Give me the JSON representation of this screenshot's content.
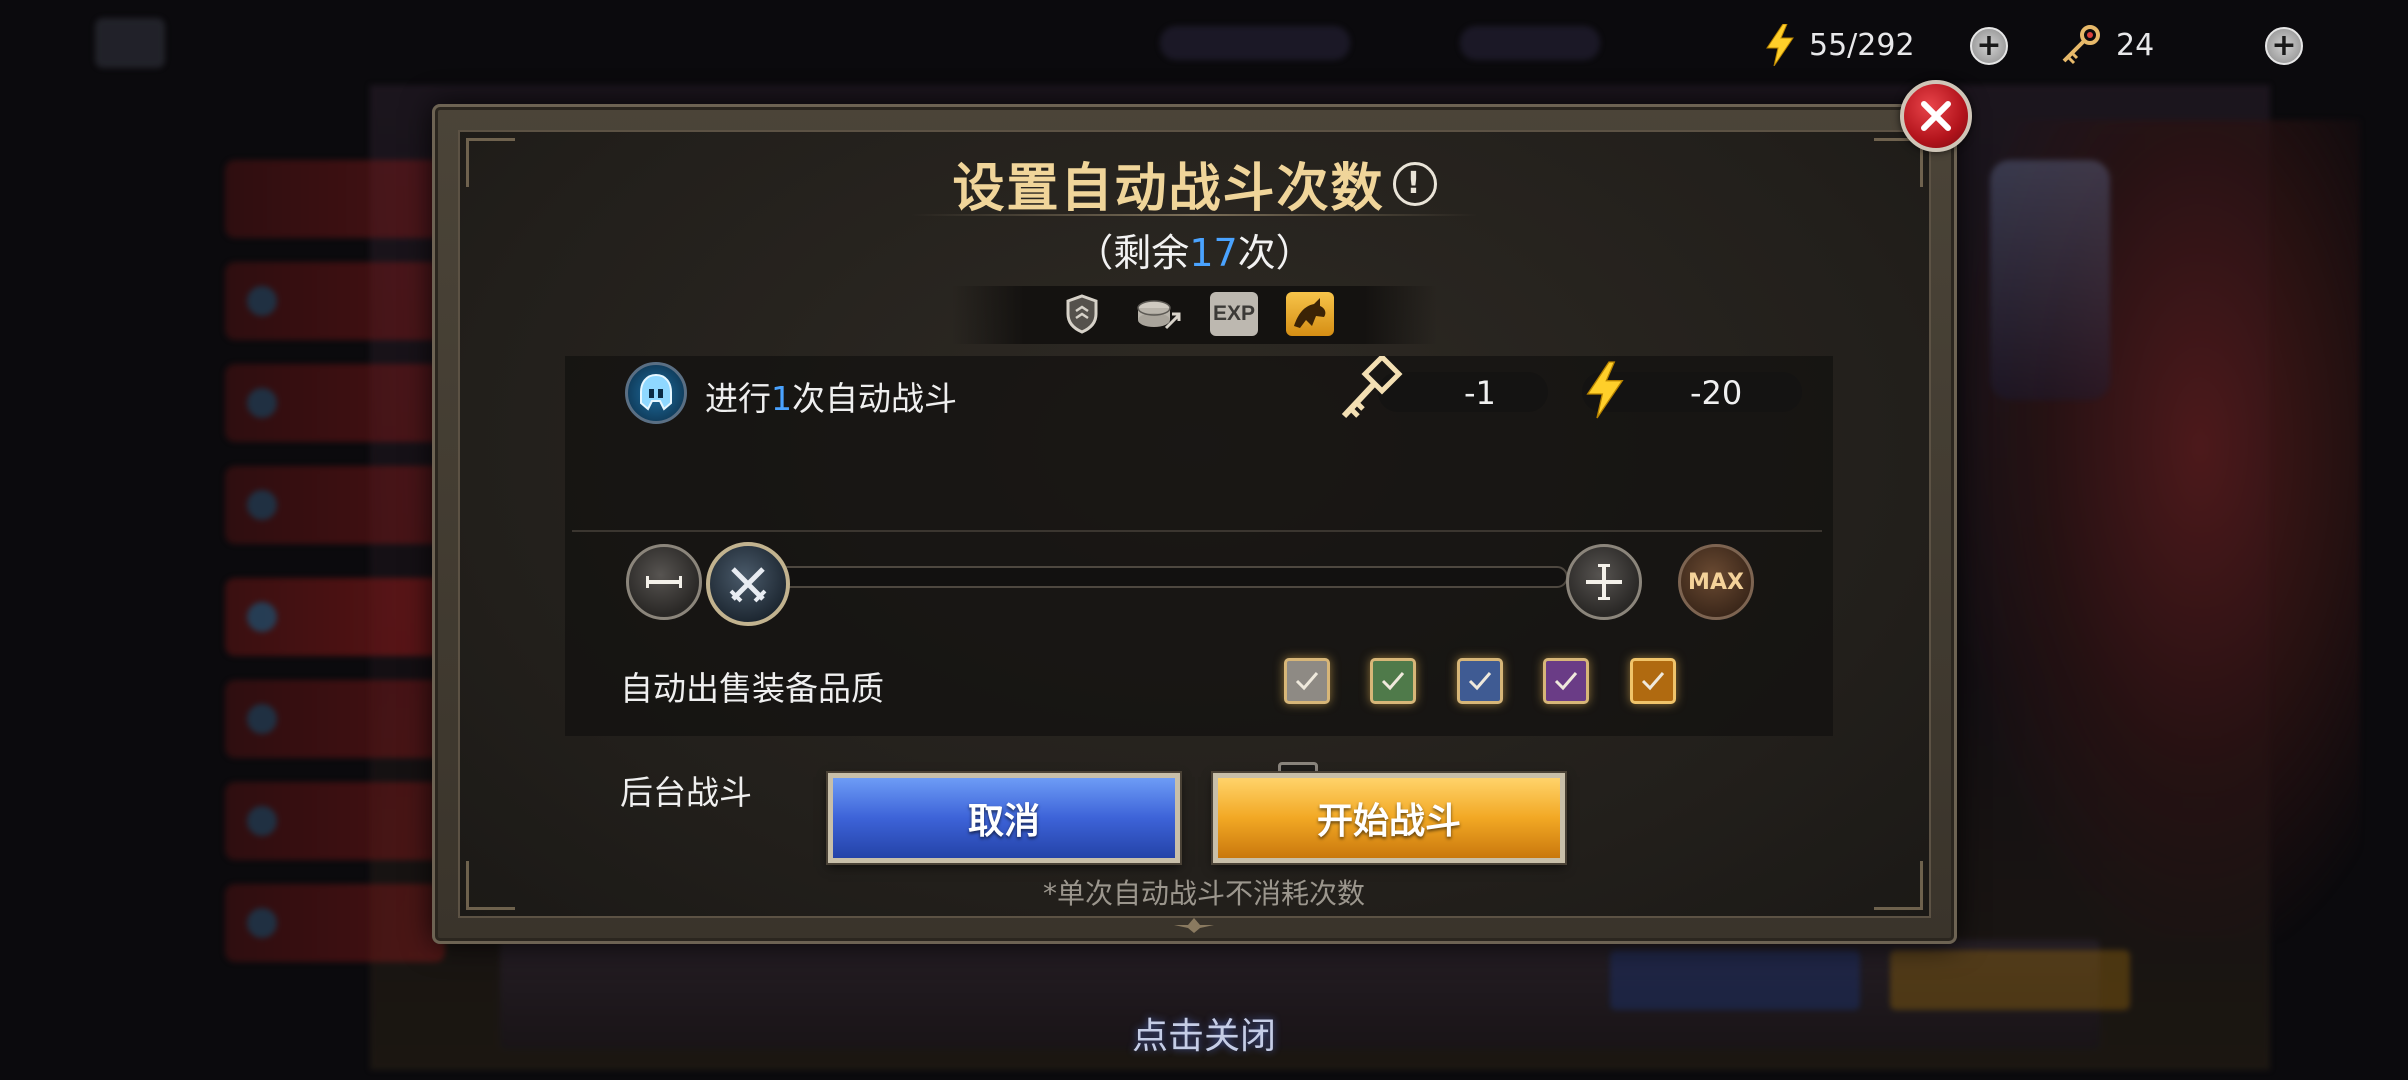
{
  "resources": {
    "energy": {
      "icon": "lightning-icon",
      "value": "55/292"
    },
    "keys": {
      "icon": "key-icon",
      "value": "24"
    }
  },
  "dialog": {
    "title": "设置自动战斗次数",
    "remaining_prefix": "（剩余",
    "remaining_count": "17",
    "remaining_suffix": "次）",
    "filters": [
      "shield-icon",
      "coins-icon",
      "exp-icon",
      "dragon-icon"
    ],
    "battle_count": {
      "prefix": "进行",
      "value": "1",
      "suffix": "次自动战斗"
    },
    "cost_key": "-1",
    "cost_energy": "-20",
    "max_label": "MAX",
    "auto_sell_label": "自动出售装备品质",
    "auto_sell_qualities": [
      {
        "quality": "white",
        "checked": true,
        "color": "#8e8a84"
      },
      {
        "quality": "green",
        "checked": true,
        "color": "#4f7a4a"
      },
      {
        "quality": "blue",
        "checked": true,
        "color": "#3f5b93"
      },
      {
        "quality": "purple",
        "checked": true,
        "color": "#6a3c86"
      },
      {
        "quality": "orange",
        "checked": true,
        "color": "#b06a10"
      }
    ],
    "background_battle_label": "后台战斗",
    "background_battle_checked": false,
    "cancel_label": "取消",
    "start_label": "开始战斗",
    "note": "*单次自动战斗不消耗次数"
  },
  "tap_to_close": "点击关闭",
  "colors": {
    "accent_blue": "#4aa3ff",
    "title_gold": "#f0d59a",
    "close_red": "#c3161e"
  }
}
